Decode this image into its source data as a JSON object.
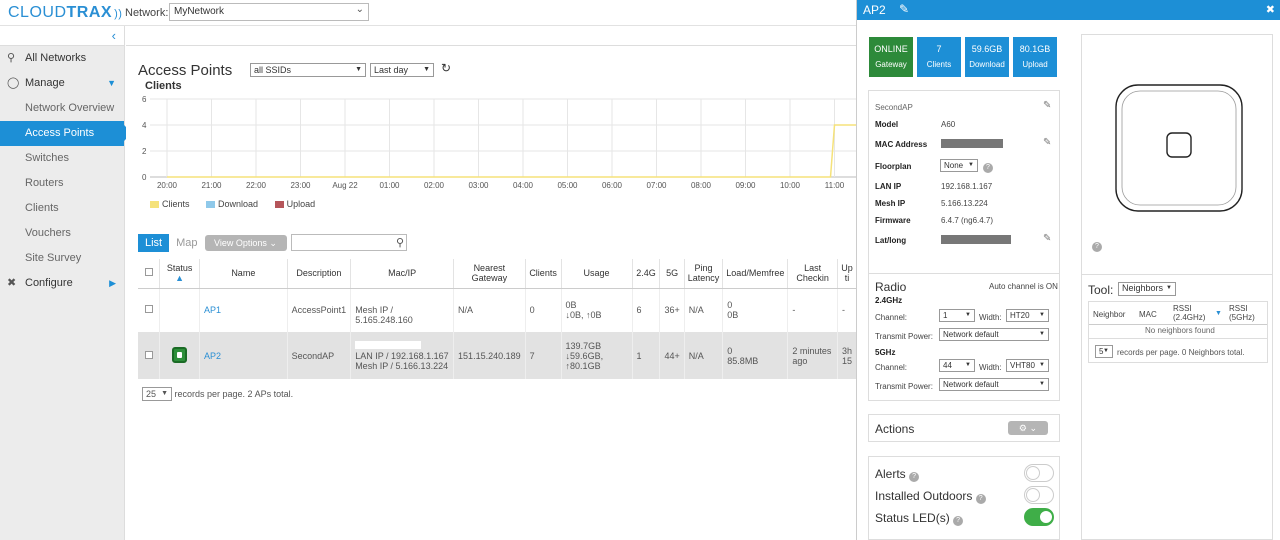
{
  "app": {
    "logo_part1": "CLOUD",
    "logo_part2": "TRAX",
    "network_label": "Network:",
    "network_value": "MyNetwork"
  },
  "sidebar": {
    "items": [
      {
        "label": "All Networks"
      },
      {
        "label": "Manage"
      },
      {
        "label": "Network Overview"
      },
      {
        "label": "Access Points"
      },
      {
        "label": "Switches"
      },
      {
        "label": "Routers"
      },
      {
        "label": "Clients"
      },
      {
        "label": "Vouchers"
      },
      {
        "label": "Site Survey"
      },
      {
        "label": "Configure"
      }
    ]
  },
  "main": {
    "title": "Access Points",
    "ssid_filter": "all SSIDs",
    "time_range": "Last day",
    "chart_title": "Clients",
    "tabs": {
      "list": "List",
      "map": "Map"
    },
    "view_options": "View Options",
    "table": {
      "headers": [
        "Status",
        "Name",
        "Description",
        "Mac/IP",
        "Nearest Gateway",
        "Clients",
        "Usage",
        "2.4G",
        "5G",
        "Ping Latency",
        "Load/Memfree",
        "Last Checkin",
        "Up ti"
      ],
      "rows": [
        {
          "name": "AP1",
          "description": "AccessPoint1",
          "mac_ip": "Mesh IP / 5.165.248.160",
          "nearest_gateway": "N/A",
          "clients": "0",
          "usage1": "0B",
          "usage2": "↓0B, ↑0B",
          "g24": "6",
          "g5": "36+",
          "ping": "N/A",
          "load1": "0",
          "load2": "0B",
          "checkin": "-",
          "uptime": "-"
        },
        {
          "name": "AP2",
          "description": "SecondAP",
          "mac_ip1": "LAN IP / 192.168.1.167",
          "mac_ip2": "Mesh IP / 5.166.13.224",
          "nearest_gateway": "151.15.240.189",
          "clients": "7",
          "usage1": "139.7GB",
          "usage2": "↓59.6GB,",
          "usage3": "↑80.1GB",
          "g24": "1",
          "g5": "44+",
          "ping": "N/A",
          "load1": "0",
          "load2": "85.8MB",
          "checkin1": "2 minutes",
          "checkin2": "ago",
          "uptime": "3h 15"
        }
      ]
    },
    "records_per_page": "25",
    "records_text": "records per page.  2 APs total."
  },
  "chart_data": {
    "type": "line",
    "title": "Clients",
    "x": [
      "20:00",
      "21:00",
      "22:00",
      "23:00",
      "Aug 22",
      "01:00",
      "02:00",
      "03:00",
      "04:00",
      "05:00",
      "06:00",
      "07:00",
      "08:00",
      "09:00",
      "10:00",
      "11:00"
    ],
    "ylim": [
      0,
      6
    ],
    "yticks": [
      0,
      2,
      4,
      6
    ],
    "series": [
      {
        "name": "Clients",
        "color": "#f5e27a",
        "values": [
          0,
          0,
          0,
          0,
          0,
          0,
          0,
          0,
          0,
          0,
          0,
          0,
          0,
          0,
          0,
          4
        ]
      },
      {
        "name": "Download",
        "color": "#8fc9ea",
        "values": []
      },
      {
        "name": "Upload",
        "color": "#b5555a",
        "values": []
      }
    ]
  },
  "detail": {
    "title": "AP2",
    "stats": [
      {
        "value": "ONLINE",
        "label": "Gateway",
        "color": "#2d8a3a"
      },
      {
        "value": "7",
        "label": "Clients",
        "color": "#1d8fd6"
      },
      {
        "value": "59.6GB",
        "label": "Download",
        "color": "#1d8fd6"
      },
      {
        "value": "80.1GB",
        "label": "Upload",
        "color": "#1d8fd6"
      }
    ],
    "info": {
      "name": "SecondAP",
      "model_label": "Model",
      "model": "A60",
      "mac_label": "MAC Address",
      "floorplan_label": "Floorplan",
      "floorplan": "None",
      "lan_ip_label": "LAN IP",
      "lan_ip": "192.168.1.167",
      "mesh_ip_label": "Mesh IP",
      "mesh_ip": "5.166.13.224",
      "firmware_label": "Firmware",
      "firmware": "6.4.7 (ng6.4.7)",
      "latlong_label": "Lat/long"
    },
    "radio": {
      "title": "Radio",
      "auto_channel": "Auto channel is ON",
      "band1": "2.4GHz",
      "channel_label": "Channel:",
      "width_label": "Width:",
      "tx_label": "Transmit Power:",
      "b1_channel": "1",
      "b1_width": "HT20",
      "b1_tx": "Network default",
      "band2": "5GHz",
      "b2_channel": "44",
      "b2_width": "VHT80",
      "b2_tx": "Network default"
    },
    "actions": "Actions",
    "toggles": [
      {
        "label": "Alerts",
        "on": false
      },
      {
        "label": "Installed Outdoors",
        "on": false
      },
      {
        "label": "Status LED(s)",
        "on": true
      }
    ],
    "tool": {
      "label": "Tool:",
      "selected": "Neighbors",
      "headers": [
        "Neighbor",
        "MAC",
        "RSSI (2.4GHz)",
        "RSSI (5GHz)"
      ],
      "empty": "No neighbors found",
      "per_page": "5",
      "footer": "records per page.  0 Neighbors total."
    }
  }
}
